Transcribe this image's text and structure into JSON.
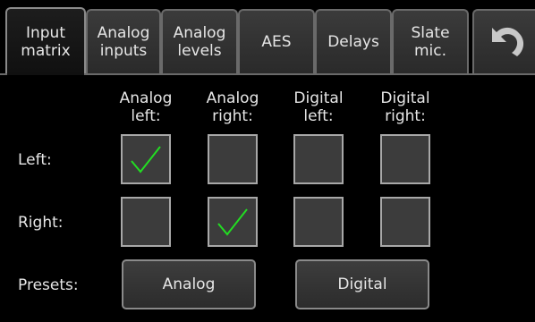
{
  "tabs": [
    {
      "label": "Input\nmatrix",
      "active": true
    },
    {
      "label": "Analog\ninputs",
      "active": false
    },
    {
      "label": "Analog\nlevels",
      "active": false
    },
    {
      "label": "AES",
      "active": false
    },
    {
      "label": "Delays",
      "active": false
    },
    {
      "label": "Slate\nmic.",
      "active": false
    }
  ],
  "undo_icon": "undo-arrow-icon",
  "columns": [
    "Analog\nleft:",
    "Analog\nright:",
    "Digital\nleft:",
    "Digital\nright:"
  ],
  "rows": [
    {
      "label": "Left:",
      "checked": [
        true,
        false,
        false,
        false
      ]
    },
    {
      "label": "Right:",
      "checked": [
        false,
        true,
        false,
        false
      ]
    }
  ],
  "presets": {
    "label": "Presets:",
    "buttons": [
      "Analog",
      "Digital"
    ]
  },
  "colors": {
    "check": "#22dd22",
    "cell_bg": "#3c3c3c",
    "cell_border": "#a8a8a8",
    "background": "#000000"
  }
}
